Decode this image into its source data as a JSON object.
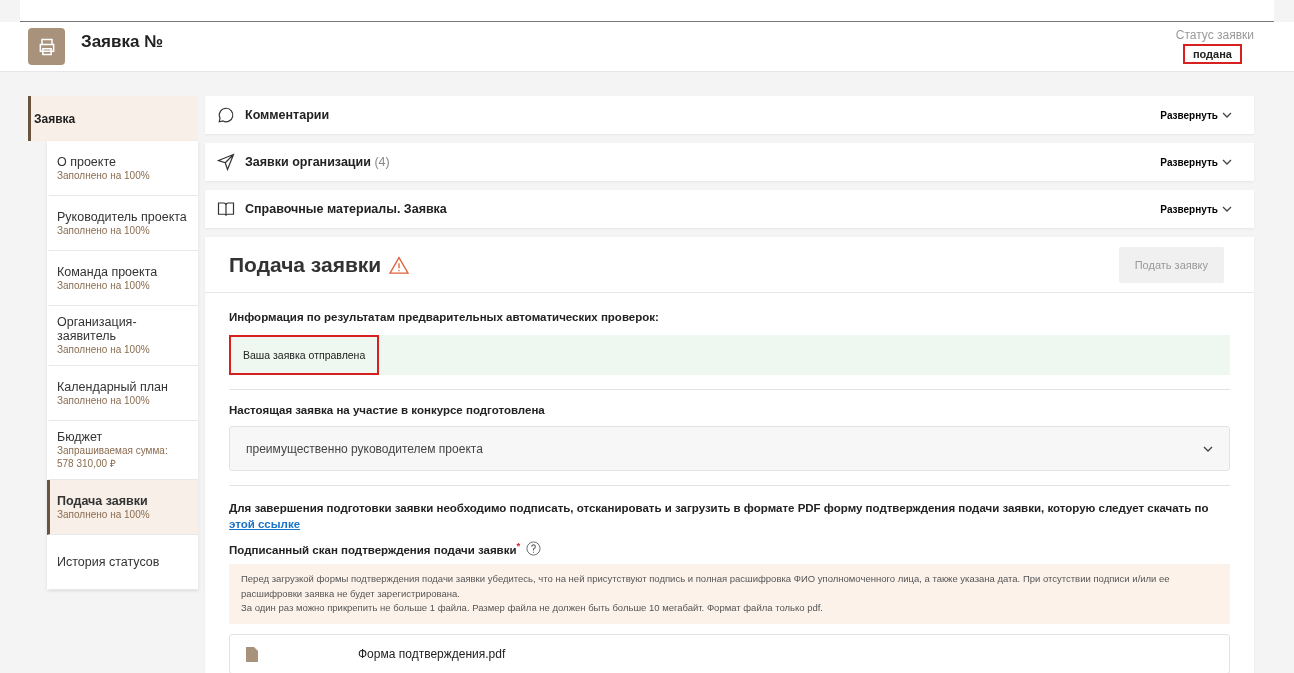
{
  "header": {
    "title": "Заявка №",
    "status_label": "Статус заявки",
    "status": "подана",
    "status_highlighted": true
  },
  "sidebar": {
    "section": {
      "label": "Заявка",
      "selected": true
    },
    "items": [
      {
        "title": "О проекте",
        "details": [
          "Заполнено на 100%"
        ],
        "selected": false
      },
      {
        "title": "Руководитель проекта",
        "details": [
          "Заполнено на 100%"
        ],
        "selected": false
      },
      {
        "title": "Команда проекта",
        "details": [
          "Заполнено на 100%"
        ],
        "selected": false
      },
      {
        "title": "Организация-заявитель",
        "details": [
          "Заполнено на 100%"
        ],
        "selected": false
      },
      {
        "title": "Календарный план",
        "details": [
          "Заполнено на 100%"
        ],
        "selected": false
      },
      {
        "title": "Бюджет",
        "details": [
          "Запрашиваемая сумма:",
          "578 310,00 ₽"
        ],
        "selected": false
      },
      {
        "title": "Подача заявки",
        "details": [
          "Заполнено на 100%"
        ],
        "selected": true
      },
      {
        "title": "История статусов",
        "selected": false
      }
    ]
  },
  "accordions": [
    {
      "kind": "comment",
      "title": "Комментарии",
      "action": "Развернуть",
      "expanded": false
    },
    {
      "kind": "send",
      "title": "Заявки организации",
      "count": "(4)",
      "action": "Развернуть",
      "expanded": false
    },
    {
      "kind": "book",
      "title": "Справочные материалы. Заявка",
      "action": "Развернуть",
      "expanded": false
    }
  ],
  "submission": {
    "title": "Подача заявки",
    "warning": true,
    "button": {
      "label": "Подать заявку",
      "disabled": true
    },
    "checks_label": "Информация по результатам предварительных автоматических проверок:",
    "message": {
      "text": "Ваша заявка отправлена",
      "highlighted": true
    },
    "prepared_label": "Настоящая заявка на участие в конкурсе подготовлена",
    "prepared_value": "преимущественно руководителем проекта",
    "instructions": "Для завершения подготовки заявки необходимо подписать, отсканировать и загрузить в формате PDF форму подтверждения подачи заявки, которую следует скачать по",
    "instructions_link": "этой ссылке",
    "upload_label": "Подписанный скан подтверждения подачи заявки",
    "required_mark": "*",
    "notice": [
      "Перед загрузкой формы подтверждения подачи заявки убедитесь, что на ней присутствуют подпись и полная расшифровка ФИО уполномоченного лица, а также указана дата. При отсутствии подписи и/или ее расшифровки заявка не будет зарегистрирована.",
      "За один раз можно прикрепить не больше 1 файла. Размер файла не должен быть больше 10 мегабайт. Формат файла только pdf."
    ],
    "file": "Форма подтверждения.pdf"
  }
}
